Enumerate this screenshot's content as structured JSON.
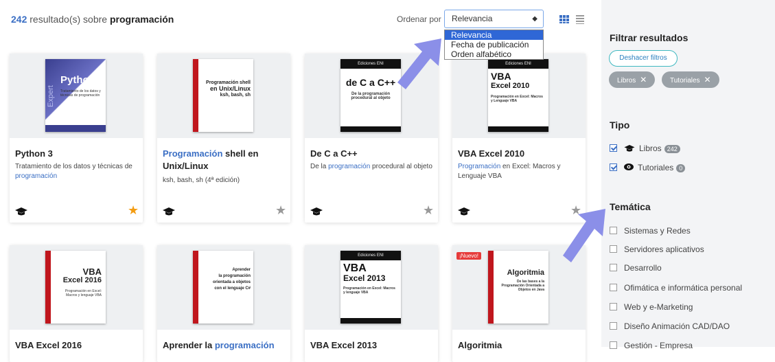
{
  "results": {
    "count": "242",
    "text": " resultado(s) sobre ",
    "query": "programación"
  },
  "sort": {
    "label": "Ordenar por",
    "selected": "Relevancia",
    "options": [
      "Relevancia",
      "Fecha de publicación",
      "Orden alfabético"
    ]
  },
  "cards": [
    {
      "title": "Python 3",
      "subtitle_a": "Tratamiento de los datos y técnicas de ",
      "subtitle_hl": "programación",
      "cover": {
        "main": "Python 3",
        "side": "Expert",
        "small": "Tratamiento de los datos y técnicas de programación"
      }
    },
    {
      "title_hl": "Programación",
      "title_rest": " shell en Unix/Linux",
      "subtitle": "ksh, bash, sh (4ª edición)",
      "cover": {
        "line1": "Programación shell",
        "line2": "en Unix/Linux",
        "line3": "ksh, bash, sh"
      }
    },
    {
      "title": "De C a C++",
      "subtitle_a": "De la ",
      "subtitle_hl": "programación",
      "subtitle_b": " procedural al objeto",
      "cover": {
        "band": "Ediciones ENI",
        "main": "de C a C++",
        "sub": "De la programación procedural al objeto"
      }
    },
    {
      "title": "VBA Excel 2010",
      "subtitle_hl": "Programación",
      "subtitle_b": " en Excel: Macros y Lenguaje VBA",
      "cover": {
        "band": "Ediciones ENI",
        "main1": "VBA",
        "main2": "Excel 2010",
        "sub": "Programación en Excel: Macros y Lenguaje VBA"
      }
    },
    {
      "title": "VBA Excel 2016",
      "cover": {
        "main1": "VBA",
        "main2": "Excel 2016",
        "sub": "Programación en Excel: Macros y lenguaje VBA"
      }
    },
    {
      "title_a": "Aprender la ",
      "title_hl": "programación",
      "cover": {
        "line1": "Aprender",
        "line2": "la programación",
        "line3": "orientada a objetos",
        "line4": "con el lenguaje C#"
      }
    },
    {
      "title": "VBA Excel 2013",
      "cover": {
        "band": "Ediciones ENI",
        "main1": "VBA",
        "main2": "Excel 2013",
        "sub": "Programación en Excel: Macros y lenguaje VBA"
      }
    },
    {
      "title": "Algoritmia",
      "badge": "¡Nuevo!",
      "cover": {
        "main": "Algoritmia",
        "sub": "De las bases a la Programación Orientada a Objetos en Java"
      }
    }
  ],
  "sidebar": {
    "filter_title": "Filtrar resultados",
    "undo": "Deshacer filtros",
    "chips": [
      "Libros",
      "Tutoriales"
    ],
    "tipo_title": "Tipo",
    "tipo": [
      {
        "label": "Libros",
        "count": "242"
      },
      {
        "label": "Tutoriales",
        "count": "0"
      }
    ],
    "tematica_title": "Temática",
    "tematica": [
      "Sistemas y Redes",
      "Servidores aplicativos",
      "Desarrollo",
      "Ofimática e informática personal",
      "Web y e-Marketing",
      "Diseño Animación CAD/DAO",
      "Gestión - Empresa"
    ]
  }
}
